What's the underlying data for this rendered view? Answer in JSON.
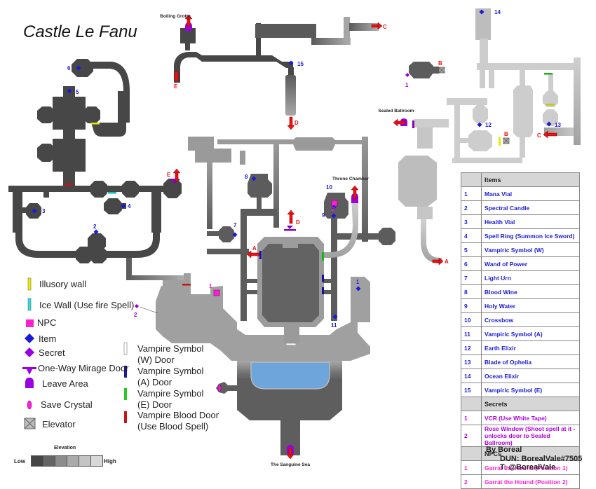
{
  "map_title": "Castle Le Fanu",
  "locations": {
    "boiling_grotto": "Boiling Grotto",
    "sealed_ballroom": "Sealed Ballroom",
    "throne_chamber": "Throne Chamber",
    "sanguine_sea": "The Sanguine Sea"
  },
  "exits": {
    "A": "A",
    "B": "B",
    "C": "C",
    "D": "D",
    "E": "E"
  },
  "item_markers": [
    "1",
    "2",
    "3",
    "4",
    "5",
    "6",
    "7",
    "8",
    "9",
    "10",
    "11",
    "12",
    "13",
    "14",
    "15"
  ],
  "secret_markers": [
    "1",
    "2"
  ],
  "npc_markers": [
    "1",
    "2"
  ],
  "legend": {
    "illusory_wall": "Illusory wall",
    "ice_wall": "Ice Wall (Use fire Spell)",
    "npc": "NPC",
    "item": "Item",
    "secret": "Secret",
    "mirage_door": "One-Way Mirage Door",
    "leave_area": "Leave Area",
    "save_crystal": "Save Crystal",
    "elevator": "Elevator",
    "door_w_1": "Vampire Symbol",
    "door_w_2": "(W) Door",
    "door_a_1": "Vampire Symbol",
    "door_a_2": "(A) Door",
    "door_e_1": "Vampire Symbol",
    "door_e_2": "(E) Door",
    "blood_door_1": "Vampire Blood Door",
    "blood_door_2": "(Use Blood Spell)"
  },
  "elevation": {
    "title": "Elevation",
    "low": "Low",
    "high": "High",
    "shades": [
      "#454545",
      "#646464",
      "#8c8c8c",
      "#ababab",
      "#c4c4c4",
      "#d8d8d8"
    ]
  },
  "table": {
    "items_header": "Items",
    "items": [
      {
        "n": "1",
        "name": "Mana Vial"
      },
      {
        "n": "2",
        "name": "Spectral Candle"
      },
      {
        "n": "3",
        "name": "Health Vial"
      },
      {
        "n": "4",
        "name": "Spell Ring (Summon Ice Sword)"
      },
      {
        "n": "5",
        "name": "Vampiric Symbol (W)"
      },
      {
        "n": "6",
        "name": "Wand of Power"
      },
      {
        "n": "7",
        "name": "Light Urn"
      },
      {
        "n": "8",
        "name": "Blood Wine"
      },
      {
        "n": "9",
        "name": "Holy Water"
      },
      {
        "n": "10",
        "name": "Crossbow"
      },
      {
        "n": "11",
        "name": "Vampiric Symbol (A)"
      },
      {
        "n": "12",
        "name": "Earth Elixir"
      },
      {
        "n": "13",
        "name": "Blade of Ophelia"
      },
      {
        "n": "14",
        "name": "Ocean Elixir"
      },
      {
        "n": "15",
        "name": "Vampiric Symbol (E)"
      }
    ],
    "secrets_header": "Secrets",
    "secrets": [
      {
        "n": "1",
        "name": "VCR (Use White Tape)"
      },
      {
        "n": "2",
        "name": "Rose Window (Shoot spell at it - unlocks door to Sealed Ballroom)"
      }
    ],
    "npcs_header": "NPCs",
    "npcs": [
      {
        "n": "1",
        "name": "Garrat the Hound (Position 1)"
      },
      {
        "n": "2",
        "name": "Garrat the Hound (Position 2)"
      }
    ]
  },
  "credits": {
    "by": "By Boreal",
    "dun": "DUN: BorealVale#7505",
    "twitter": "T: @BorealVale"
  },
  "colors": {
    "item": "#1a1ad8",
    "secret": "#9b00e0",
    "npc": "#ff1fd0",
    "exit": "#ee1111",
    "water": "#6ea6dc"
  }
}
